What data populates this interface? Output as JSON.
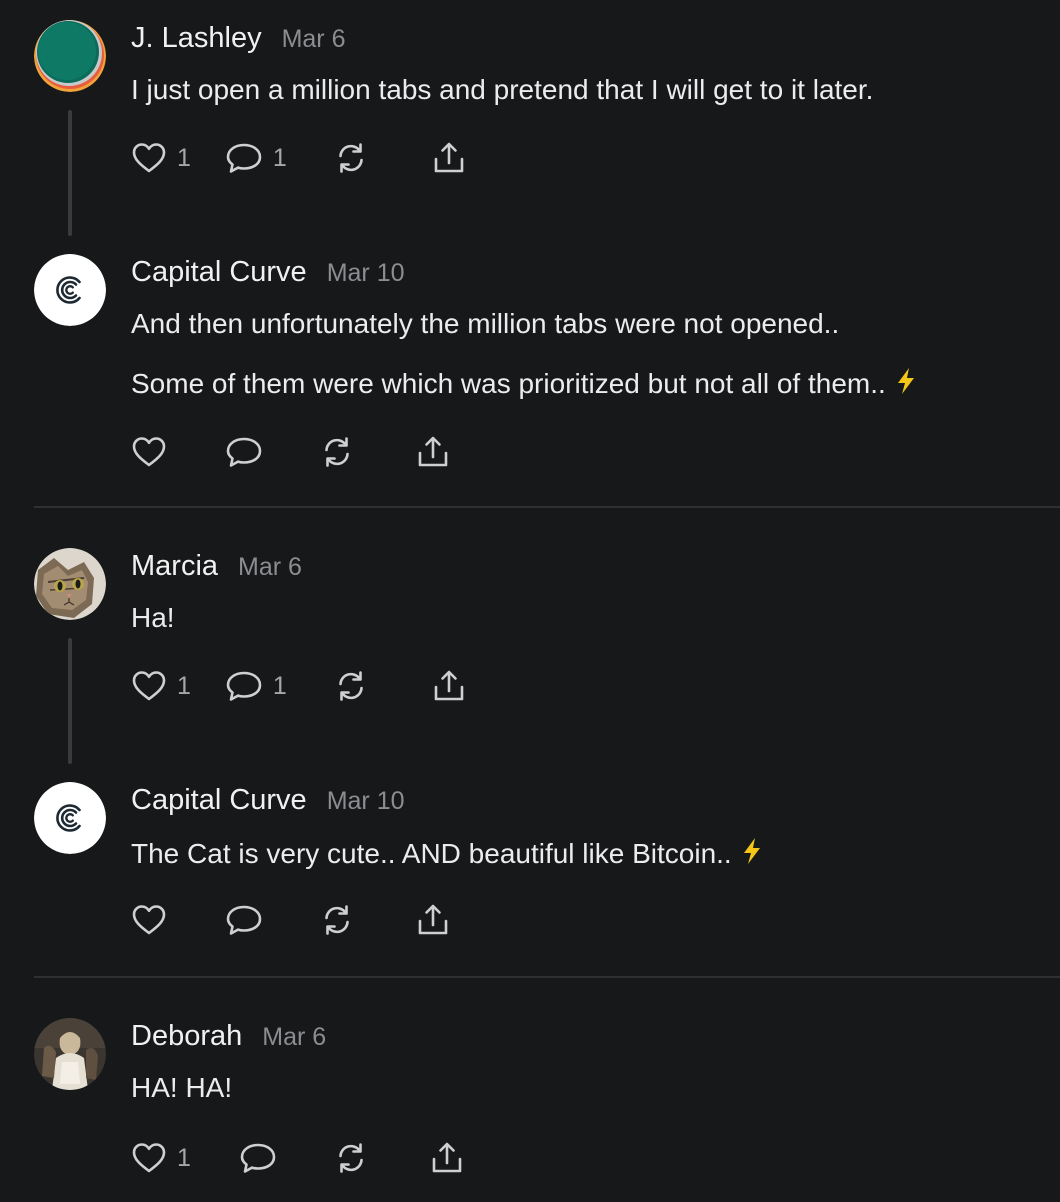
{
  "posts": [
    {
      "author": "J. Lashley",
      "date": "Mar 6",
      "lines": [
        "I just open a million tabs and pretend that I will get to it later."
      ],
      "like_count": "1",
      "comment_count": "1"
    },
    {
      "author": "Capital Curve",
      "date": "Mar 10",
      "lines": [
        "And then unfortunately the million tabs were not opened..",
        "Some of them were which was prioritized but not all of them.."
      ],
      "like_count": "",
      "comment_count": ""
    },
    {
      "author": "Marcia",
      "date": "Mar 6",
      "lines": [
        "Ha!"
      ],
      "like_count": "1",
      "comment_count": "1"
    },
    {
      "author": "Capital Curve",
      "date": "Mar 10",
      "lines": [
        "The Cat is very cute.. AND beautiful like Bitcoin.."
      ],
      "like_count": "",
      "comment_count": ""
    },
    {
      "author": "Deborah",
      "date": "Mar 6",
      "lines": [
        "HA! HA!"
      ],
      "like_count": "1",
      "comment_count": ""
    }
  ],
  "icons": {
    "like": "heart-icon",
    "comment": "comment-icon",
    "restack": "restack-icon",
    "share": "share-icon",
    "bolt": "lightning-icon"
  },
  "colors": {
    "background": "#17181a",
    "text": "#ececec",
    "muted": "#8c8d90",
    "bolt": "#f5c518"
  }
}
